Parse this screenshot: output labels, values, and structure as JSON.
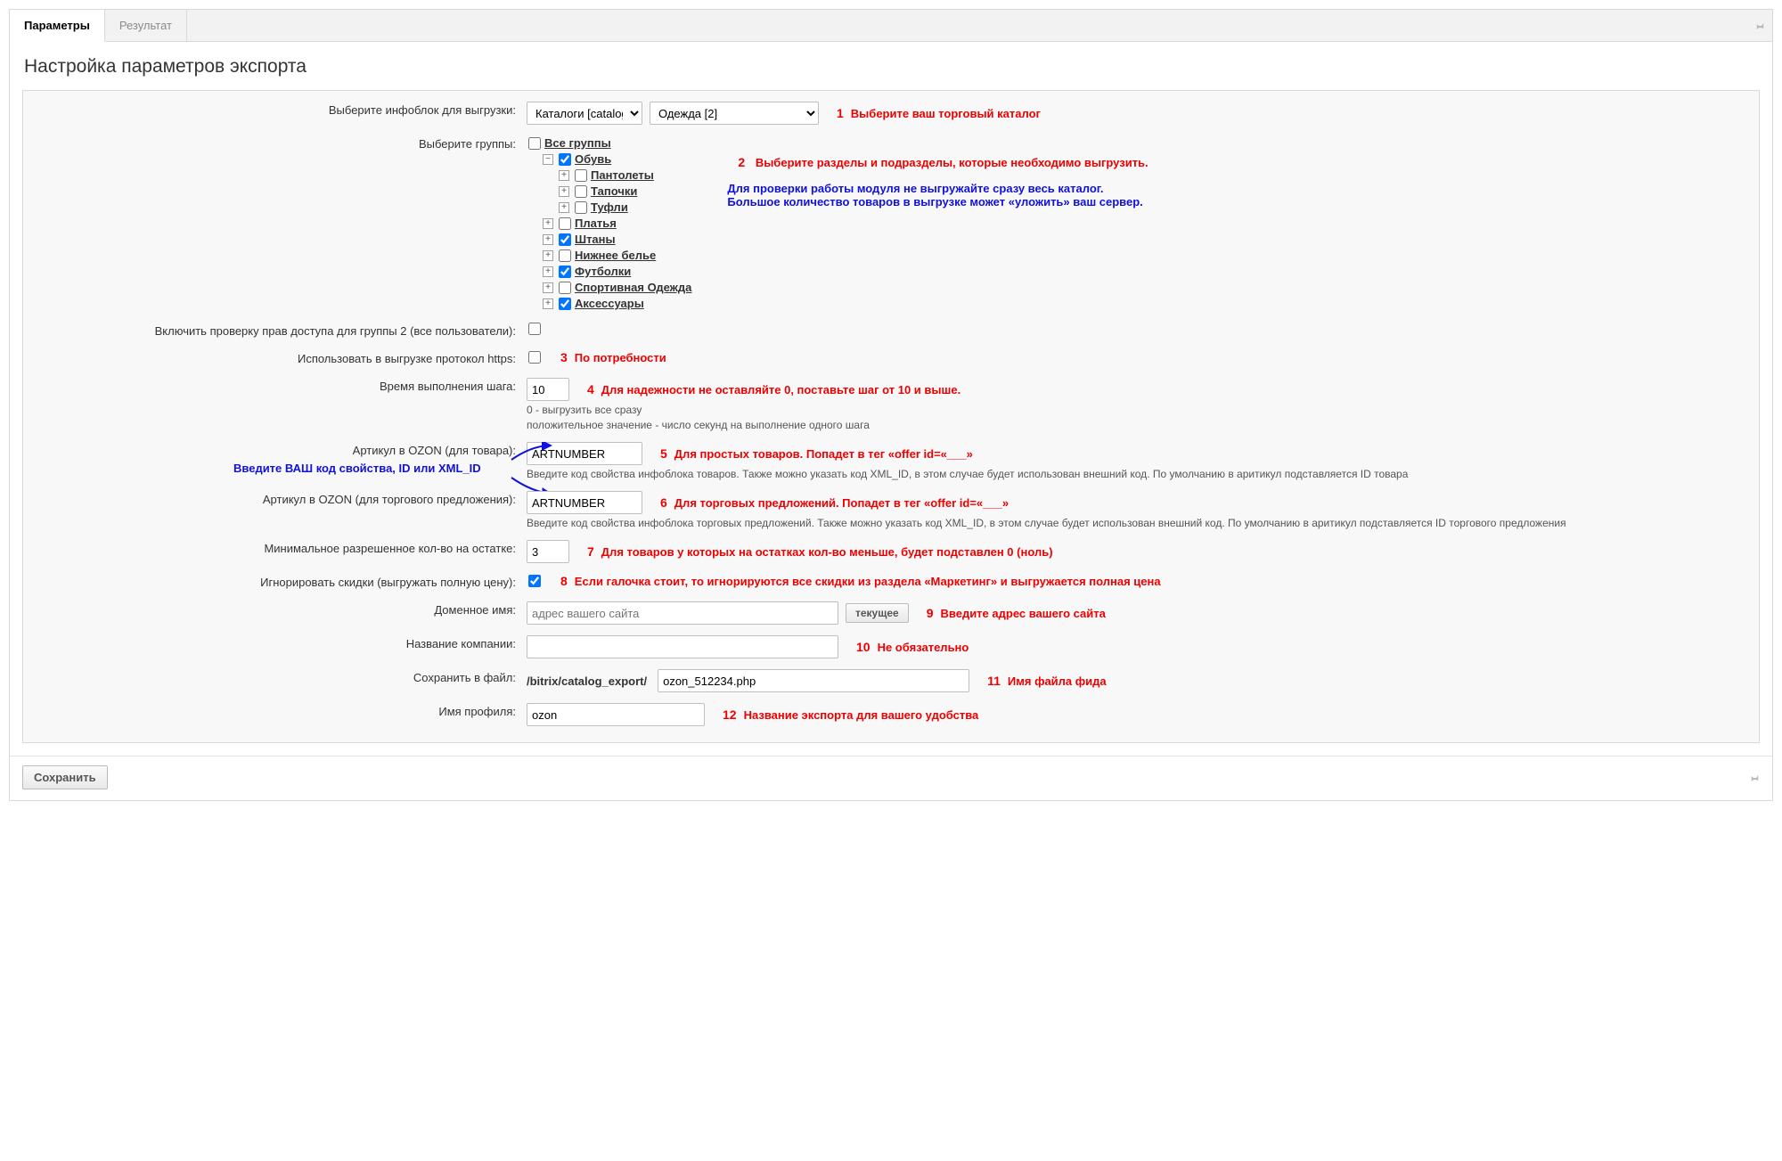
{
  "tabs": {
    "params": "Параметры",
    "result": "Результат"
  },
  "title": "Настройка параметров экспорта",
  "labels": {
    "iblock": "Выберите инфоблок для выгрузки:",
    "groups": "Выберите группы:",
    "perm_check": "Включить проверку прав доступа для группы 2 (все пользователи):",
    "https": "Использовать в выгрузке протокол https:",
    "step": "Время выполнения шага:",
    "art_product": "Артикул в OZON (для товара):",
    "art_offer": "Артикул в OZON (для торгового предложения):",
    "min_stock": "Минимальное разрешенное кол-во на остатке:",
    "ignore_disc": "Игнорировать скидки (выгружать полную цену):",
    "domain": "Доменное имя:",
    "company": "Название компании:",
    "file": "Сохранить в файл:",
    "profile": "Имя профиля:"
  },
  "selects": {
    "iblock_type": "Каталоги [catalog]",
    "iblock": "Одежда [2]"
  },
  "tree": {
    "root": "Все группы",
    "obuv": "Обувь",
    "obuv_children": [
      "Пантолеты",
      "Тапочки",
      "Туфли"
    ],
    "others": [
      "Платья",
      "Штаны",
      "Нижнее белье",
      "Футболки",
      "Спортивная Одежда",
      "Аксессуары"
    ],
    "checked": {
      "root": false,
      "obuv": true,
      "Штаны": true,
      "Футболки": true,
      "Аксессуары": true
    }
  },
  "values": {
    "step": "10",
    "art_product": "ARTNUMBER",
    "art_offer": "ARTNUMBER",
    "min_stock": "3",
    "ignore_disc": true,
    "domain": "",
    "company": "",
    "file_path_prefix": "/bitrix/catalog_export/",
    "file": "ozon_512234.php",
    "profile": "ozon",
    "domain_placeholder": "адрес вашего сайта"
  },
  "hints": {
    "step_hint_a": "0 - выгрузить все сразу",
    "step_hint_b": "положительное значение - число секунд на выполнение одного шага",
    "art_product_hint": "Введите код свойства инфоблока товаров. Также можно указать код XML_ID, в этом случае будет использован внешний код. По умолчанию в аритикул подставляется ID товара",
    "art_offer_hint": "Введите код свойства инфоблока торговых предложений. Также можно указать код XML_ID, в этом случае будет использован внешний код. По умолчанию в аритикул подставляется ID торгового предложения"
  },
  "annotations": {
    "n1": "1",
    "t1": "Выберите ваш торговый каталог",
    "n2": "2",
    "t2": "Выберите разделы и подразделы, которые необходимо выгрузить.",
    "t2b": "Для проверки работы модуля не выгружайте сразу весь каталог.\nБольшое количество товаров в выгрузке может «уложить» ваш сервер.",
    "n3": "3",
    "t3": "По потребности",
    "n4": "4",
    "t4": "Для надежности не оставляйте 0, поставьте шаг от 10 и выше.",
    "n5": "5",
    "t5": "Для простых товаров. Попадет в тег «offer id=«___»",
    "n6": "6",
    "t6": "Для торговых предложений. Попадет в тег «offer id=«___»",
    "n7": "7",
    "t7": "Для товаров у которых на остатках кол-во меньше, будет подставлен 0 (ноль)",
    "n8": "8",
    "t8": "Если галочка стоит, то игнорируются все скидки из раздела «Маркетинг» и выгружается полная цена",
    "n9": "9",
    "t9": "Введите адрес вашего сайта",
    "n10": "10",
    "t10": "Не обязательно",
    "n11": "11",
    "t11": "Имя файла фида",
    "n12": "12",
    "t12": "Название экспорта для вашего удобства",
    "blue_hint": "Введите ВАШ код свойства, ID или XML_ID"
  },
  "buttons": {
    "current": "текущее",
    "save": "Сохранить"
  }
}
